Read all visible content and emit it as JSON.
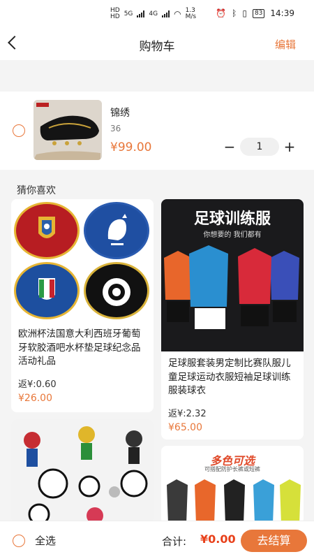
{
  "status": {
    "net_left": "HD",
    "net_left2": "HD",
    "sig1": "5G",
    "sig2": "4G",
    "speed": "1.3",
    "speed_unit": "M/s",
    "battery": "83",
    "time": "14:39"
  },
  "header": {
    "title": "购物车",
    "edit": "编辑"
  },
  "cart_item": {
    "name": "锦绣",
    "spec": "36",
    "price": "¥99.00",
    "qty": "1",
    "minus": "−",
    "plus": "+"
  },
  "recommend": {
    "title": "猜你喜欢",
    "items": [
      {
        "desc": "欧洲杯法国意大利西班牙葡萄牙软胶酒吧水杯垫足球纪念品活动礼品",
        "rebate": "返¥:0.60",
        "price": "¥26.00"
      },
      {
        "banner": "足球训练服",
        "banner_sub": "你想要的  我们都有",
        "desc": "足球服套装男定制比赛队服儿童足球运动衣服短袖足球训练服装球衣",
        "rebate": "返¥:2.32",
        "price": "¥65.00"
      },
      {
        "desc": ""
      },
      {
        "banner": "多色可选",
        "banner_sub": "可搭配防护长裤或短裤",
        "desc": ""
      }
    ]
  },
  "bottom": {
    "select_all": "全选",
    "total_label": "合计:",
    "total_value": "¥0.00",
    "checkout": "去结算"
  },
  "colors": {
    "accent": "#e8773a",
    "total": "#e8401a"
  }
}
